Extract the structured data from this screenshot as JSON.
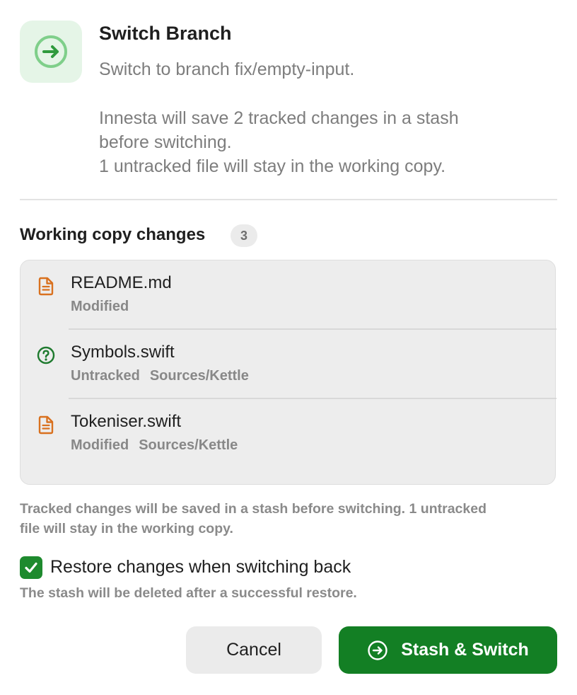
{
  "dialog": {
    "title": "Switch Branch",
    "subtitle": "Switch to branch fix/empty-input.",
    "description_lines": [
      "Innesta will save 2 tracked changes in a stash",
      "before switching.",
      "1 untracked file will stay in the working copy."
    ],
    "icon": "arrow-circle-right-icon"
  },
  "changes": {
    "title": "Working copy changes",
    "count": "3",
    "files": [
      {
        "name": "README.md",
        "status": "Modified",
        "path": "",
        "icon": "document-icon"
      },
      {
        "name": "Symbols.swift",
        "status": "Untracked",
        "path": "Sources/Kettle",
        "icon": "question-circle-icon"
      },
      {
        "name": "Tokeniser.swift",
        "status": "Modified",
        "path": "Sources/Kettle",
        "icon": "document-icon"
      }
    ]
  },
  "note_lines": [
    "Tracked changes will be saved in a stash before switching. 1 untracked",
    "file will stay in the working copy."
  ],
  "restore": {
    "checked": true,
    "label": "Restore changes when switching back",
    "help": "The stash will be deleted after a successful restore."
  },
  "buttons": {
    "cancel": "Cancel",
    "primary": "Stash & Switch"
  },
  "colors": {
    "accent": "#137f24",
    "modified_icon": "#d9711f",
    "untracked_icon": "#1e7a2e",
    "icon_tile": "#e5f5e7"
  }
}
